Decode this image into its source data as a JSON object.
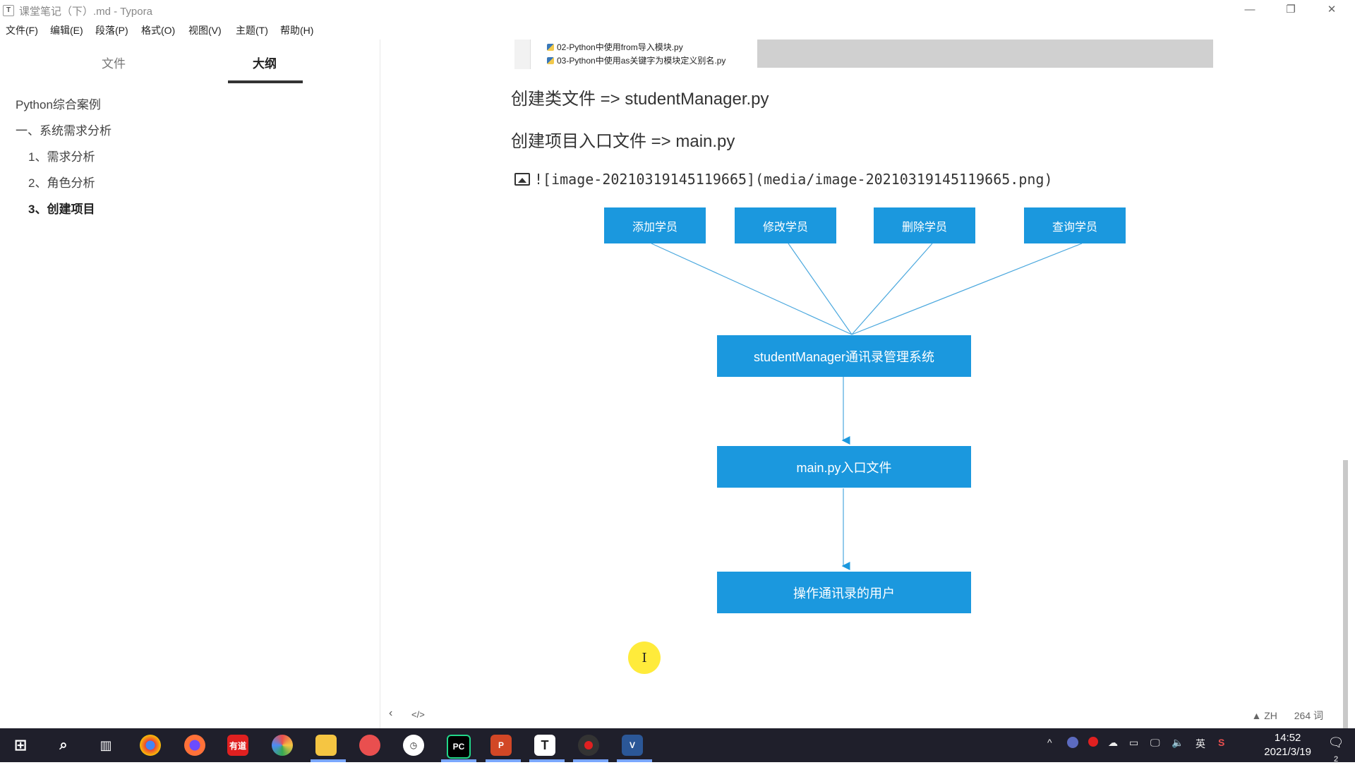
{
  "window": {
    "title": "课堂笔记（下）.md - Typora",
    "app_icon_letter": "T",
    "controls": {
      "minimize": "—",
      "restore": "❐",
      "close": "✕"
    }
  },
  "menu": [
    "文件(F)",
    "编辑(E)",
    "段落(P)",
    "格式(O)",
    "视图(V)",
    "主题(T)",
    "帮助(H)"
  ],
  "sidebar": {
    "tabs": [
      {
        "label": "文件",
        "active": false
      },
      {
        "label": "大纲",
        "active": true
      }
    ],
    "outline": [
      {
        "label": "Python综合案例",
        "level": 1,
        "active": false
      },
      {
        "label": "一、系统需求分析",
        "level": 1,
        "active": false
      },
      {
        "label": "1、需求分析",
        "level": 2,
        "active": false
      },
      {
        "label": "2、角色分析",
        "level": 2,
        "active": false
      },
      {
        "label": "3、创建项目",
        "level": 2,
        "active": true
      }
    ]
  },
  "editor": {
    "files": [
      "02-Python中使用from导入模块.py",
      "03-Python中使用as关键字为模块定义别名.py"
    ],
    "heading1": "创建类文件 => studentManager.py",
    "heading2": "创建项目入口文件 => main.py",
    "image_markdown": "![image-20210319145119665](media/image-20210319145119665.png)",
    "diagram": {
      "top_nodes": [
        "添加学员",
        "修改学员",
        "删除学员",
        "查询学员"
      ],
      "system_node": "studentManager通讯录管理系统",
      "entry_node": "main.py入口文件",
      "user_node": "操作通讯录的用户"
    },
    "cursor_glyph": "I"
  },
  "status_bar": {
    "left_icons": [
      "chevron-left-icon",
      "code-icon"
    ],
    "lang": "ZH",
    "word_count": "264 词"
  },
  "taskbar": {
    "apps": [
      {
        "name": "windows-start-icon",
        "color": "#ffffff"
      },
      {
        "name": "search-icon",
        "color": "#ffffff"
      },
      {
        "name": "task-view-icon",
        "color": "#ffffff"
      },
      {
        "name": "chrome-icon",
        "color": "#f4b400"
      },
      {
        "name": "firefox-icon",
        "color": "#ff7139"
      },
      {
        "name": "youdao-icon",
        "color": "#e02020",
        "text": "有道"
      },
      {
        "name": "browser-icon",
        "color": "#4c8bf5"
      },
      {
        "name": "folder-icon",
        "color": "#f5c542"
      },
      {
        "name": "app-icon",
        "color": "#e94f4f"
      },
      {
        "name": "app-icon",
        "color": "#ffffff"
      },
      {
        "name": "pycharm-icon",
        "color": "#21d789",
        "text": "PC"
      },
      {
        "name": "powerpoint-icon",
        "color": "#d24726",
        "text": "P"
      },
      {
        "name": "typora-icon",
        "color": "#ffffff",
        "text": "T"
      },
      {
        "name": "recorder-icon",
        "color": "#e02020"
      },
      {
        "name": "visio-icon",
        "color": "#2b5797",
        "text": "V"
      }
    ],
    "tray": [
      "^",
      "英"
    ],
    "time": "14:52",
    "date": "2021/3/19",
    "notifications": "2"
  }
}
